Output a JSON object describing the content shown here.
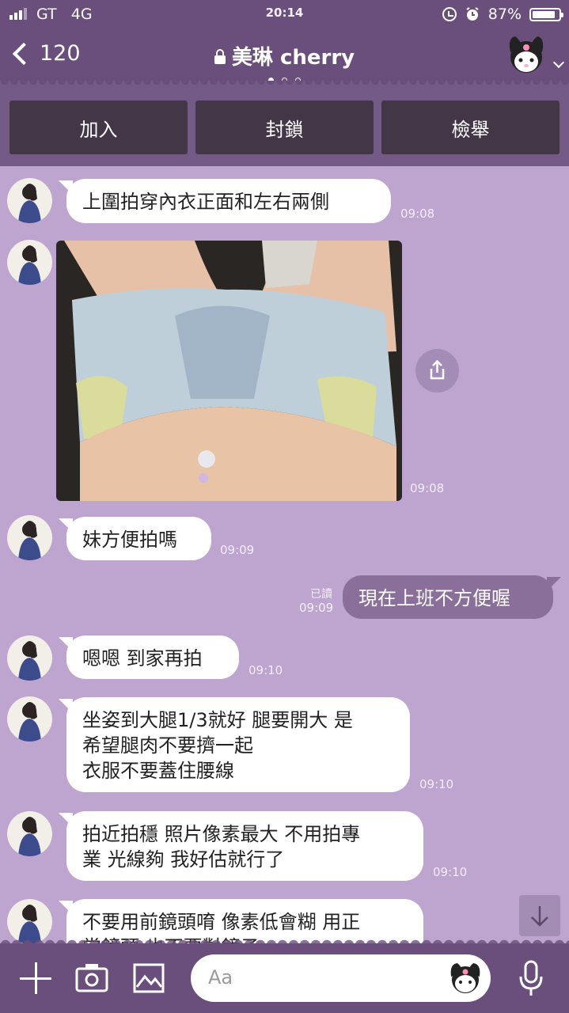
{
  "status_bar": {
    "carrier": "GT",
    "network": "4G",
    "time": "20:14",
    "battery": "87%",
    "battery_level": 0.87,
    "icons": [
      "signal-icon",
      "rotation-lock-icon",
      "alarm-icon",
      "battery-icon"
    ]
  },
  "header": {
    "back_count": "120",
    "title": "美琳 cherry",
    "page_dots": 3,
    "active_dot": 0,
    "icons": [
      "back-chevron-icon",
      "lock-icon",
      "kuromi-mascot-icon",
      "chevron-down-icon"
    ]
  },
  "actions": {
    "add": "加入",
    "block": "封鎖",
    "report": "檢舉"
  },
  "messages": [
    {
      "text": "上圍拍穿內衣正面和左右兩側",
      "time": "09:08"
    },
    {
      "type": "image",
      "time": "09:08",
      "share_icon": "share-icon"
    },
    {
      "text": "妹方便拍嗎",
      "time": "09:09"
    },
    {
      "text": "現在上班不方便喔",
      "time": "09:09",
      "read": "已讀"
    },
    {
      "text": "嗯嗯 到家再拍",
      "time": "09:10"
    },
    {
      "text": "坐姿到大腿1/3就好 腿要開大 是\n希望腿肉不要擠一起\n衣服不要蓋住腰線",
      "time": "09:10"
    },
    {
      "text": "拍近拍穩 照片像素最大 不用拍專\n業 光線夠 我好估就行了",
      "time": "09:10"
    },
    {
      "text": "不要用前鏡頭唷 像素低會糊 用正\n常鏡頭 也不要對鏡子",
      "time": ""
    }
  ],
  "composer": {
    "placeholder": "Aa",
    "icons": [
      "plus-icon",
      "camera-icon",
      "image-icon",
      "sticker-icon",
      "microphone-icon",
      "scroll-down-icon"
    ]
  },
  "colors": {
    "header": "#6a4f7c",
    "chat_bg": "#bda5d0",
    "button": "#423647",
    "outgoing_bubble": "#8b6f9b",
    "incoming_bubble": "#ffffff"
  }
}
